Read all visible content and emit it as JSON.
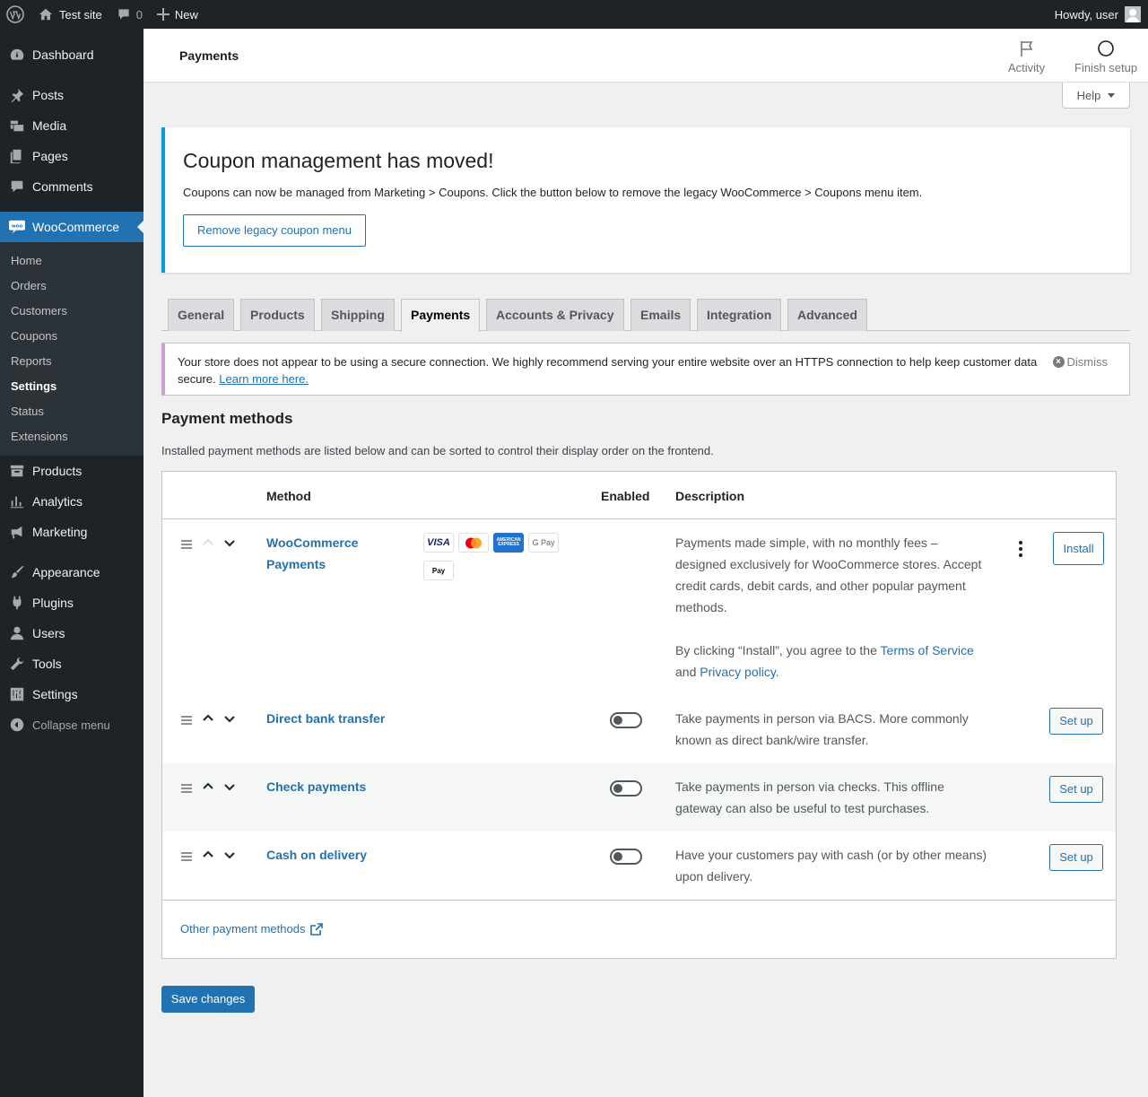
{
  "adminbar": {
    "site_name": "Test site",
    "comments_count": "0",
    "new_label": "New",
    "howdy": "Howdy, user"
  },
  "sidebar": {
    "items_top": [
      {
        "label": "Dashboard",
        "icon": "dashboard-icon"
      }
    ],
    "items_content": [
      {
        "label": "Posts",
        "icon": "pin-icon"
      },
      {
        "label": "Media",
        "icon": "media-icon"
      },
      {
        "label": "Pages",
        "icon": "pages-icon"
      },
      {
        "label": "Comments",
        "icon": "comments-icon"
      }
    ],
    "woocommerce": "WooCommerce",
    "woo_submenu": [
      "Home",
      "Orders",
      "Customers",
      "Coupons",
      "Reports",
      "Settings",
      "Status",
      "Extensions"
    ],
    "items_commerce": [
      {
        "label": "Products",
        "icon": "archive-icon"
      },
      {
        "label": "Analytics",
        "icon": "bar-chart-icon"
      },
      {
        "label": "Marketing",
        "icon": "megaphone-icon"
      }
    ],
    "items_admin": [
      {
        "label": "Appearance",
        "icon": "brush-icon"
      },
      {
        "label": "Plugins",
        "icon": "plug-icon"
      },
      {
        "label": "Users",
        "icon": "user-icon"
      },
      {
        "label": "Tools",
        "icon": "wrench-icon"
      },
      {
        "label": "Settings",
        "icon": "sliders-icon"
      }
    ],
    "collapse": "Collapse menu"
  },
  "header": {
    "title": "Payments",
    "activity": "Activity",
    "finish_setup": "Finish setup",
    "help": "Help"
  },
  "coupon_notice": {
    "title": "Coupon management has moved!",
    "text": "Coupons can now be managed from Marketing > Coupons. Click the button below to remove the legacy WooCommerce > Coupons menu item.",
    "button": "Remove legacy coupon menu"
  },
  "tabs": [
    "General",
    "Products",
    "Shipping",
    "Payments",
    "Accounts & Privacy",
    "Emails",
    "Integration",
    "Advanced"
  ],
  "https_notice": {
    "text": "Your store does not appear to be using a secure connection. We highly recommend serving your entire website over an HTTPS connection to help keep customer data secure.",
    "link": "Learn more here.",
    "dismiss": "Dismiss"
  },
  "section": {
    "title": "Payment methods",
    "intro": "Installed payment methods are listed below and can be sorted to control their display order on the frontend."
  },
  "table": {
    "headers": {
      "method": "Method",
      "enabled": "Enabled",
      "description": "Description"
    },
    "wcpay": {
      "name_line1": "WooCommerce",
      "name_line2": "Payments",
      "cards": [
        "VISA",
        "Mastercard",
        "AMERICAN EXPRESS",
        "G Pay",
        "Apple Pay"
      ],
      "desc": "Payments made simple, with no monthly fees – designed exclusively for WooCommerce stores. Accept credit cards, debit cards, and other popular payment methods.",
      "terms_prefix": "By clicking “Install”, you agree to the ",
      "terms_link": "Terms of Service",
      "terms_and": "and ",
      "privacy_link": "Privacy policy",
      "terms_end": ".",
      "button": "Install"
    },
    "rows": [
      {
        "name": "Direct bank transfer",
        "desc": "Take payments in person via BACS. More commonly known as direct bank/wire transfer.",
        "button": "Set up"
      },
      {
        "name": "Check payments",
        "desc": "Take payments in person via checks. This offline gateway can also be useful to test purchases.",
        "button": "Set up"
      },
      {
        "name": "Cash on delivery",
        "desc": "Have your customers pay with cash (or by other means) upon delivery.",
        "button": "Set up"
      }
    ],
    "other_link": "Other payment methods"
  },
  "save_button": "Save changes"
}
